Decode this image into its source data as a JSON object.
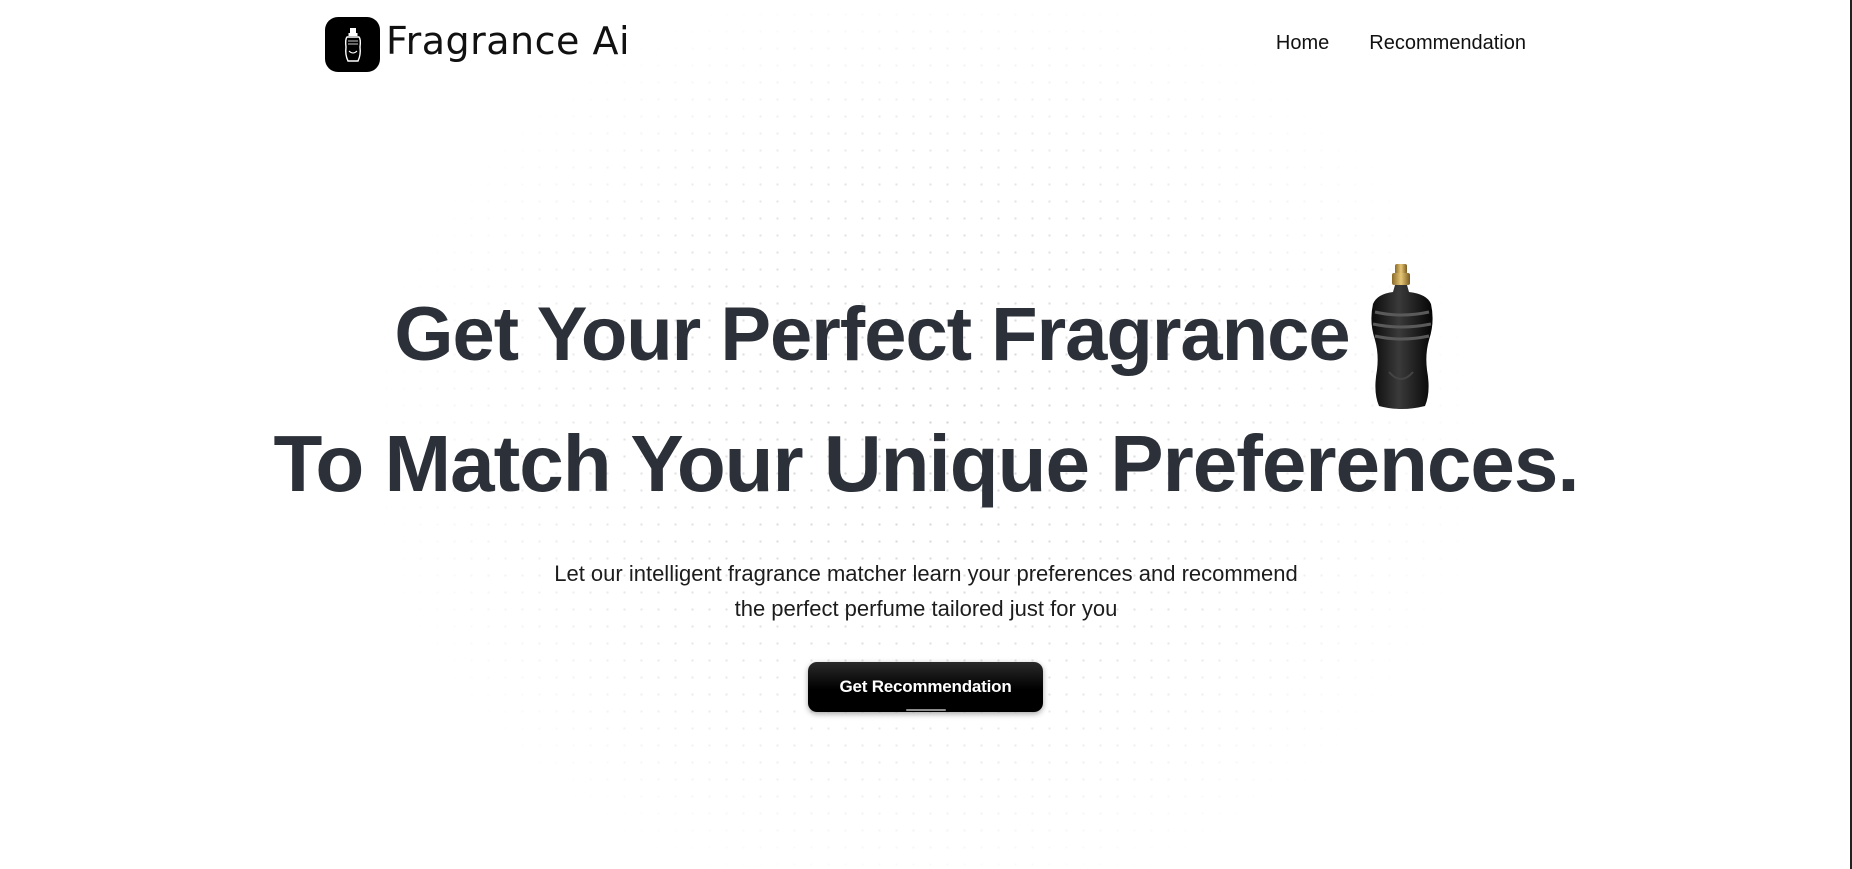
{
  "brand": {
    "name": "Fragrance Ai",
    "logo_icon": "perfume-bottle-icon"
  },
  "nav": {
    "items": [
      {
        "label": "Home"
      },
      {
        "label": "Recommendation"
      }
    ]
  },
  "hero": {
    "headline_line1": "Get Your Perfect Fragrance",
    "headline_line2": "To Match Your Unique Preferences.",
    "hero_image": "perfume-bottle-icon",
    "subtitle_line1": "Let our intelligent fragrance matcher learn your preferences and recommend",
    "subtitle_line2": "the perfect perfume tailored just for you",
    "cta_label": "Get Recommendation"
  },
  "colors": {
    "headline": "#2c3139",
    "button_bg": "#000000",
    "button_text": "#ffffff",
    "background": "#ffffff"
  }
}
